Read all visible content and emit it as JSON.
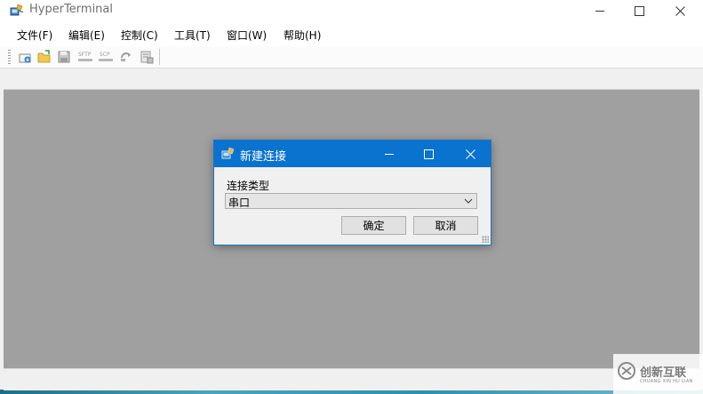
{
  "window": {
    "title": "HyperTerminal",
    "controls": {
      "minimize": "—",
      "maximize": "☐",
      "close": "✕"
    }
  },
  "menubar": {
    "items": [
      {
        "label": "文件(F)"
      },
      {
        "label": "编辑(E)"
      },
      {
        "label": "控制(C)"
      },
      {
        "label": "工具(T)"
      },
      {
        "label": "窗口(W)"
      },
      {
        "label": "帮助(H)"
      }
    ]
  },
  "toolbar": {
    "buttons": [
      {
        "icon": "new-connection-icon"
      },
      {
        "icon": "open-folder-icon"
      },
      {
        "icon": "save-icon"
      },
      {
        "icon": "sftp-icon",
        "label": "SFTP"
      },
      {
        "icon": "scp-icon",
        "label": "SCP"
      },
      {
        "icon": "reconnect-icon"
      },
      {
        "icon": "properties-icon"
      }
    ]
  },
  "dialog": {
    "title": "新建连接",
    "field_label": "连接类型",
    "connection_type": "串口",
    "ok_label": "确定",
    "cancel_label": "取消"
  },
  "watermark": {
    "text": "创新互联",
    "subtext": "CHUANG XIN HU LIAN"
  },
  "colors": {
    "dialog_title_bg": "#0a72cf",
    "workspace_bg": "#a0a0a0",
    "chrome_bg": "#f0f0f0"
  }
}
